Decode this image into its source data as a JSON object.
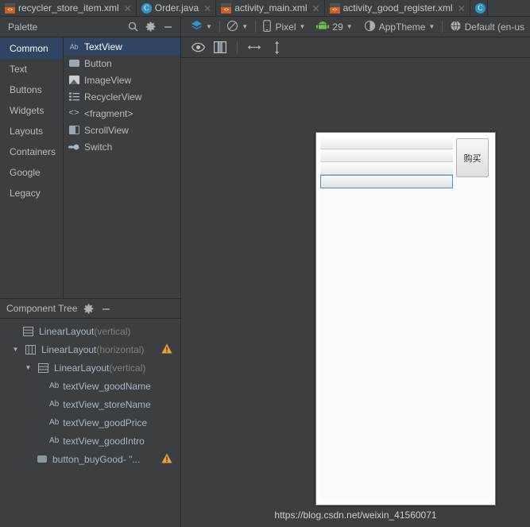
{
  "tabs": [
    {
      "label": "recycler_store_item.xml",
      "icon": "xml-file-icon",
      "active": true,
      "closeable": true
    },
    {
      "label": "Order.java",
      "icon": "java-class-icon",
      "active": false,
      "closeable": true
    },
    {
      "label": "activity_main.xml",
      "icon": "xml-file-icon",
      "active": false,
      "closeable": true
    },
    {
      "label": "activity_good_register.xml",
      "icon": "xml-file-icon",
      "active": false,
      "closeable": true
    },
    {
      "label": "",
      "icon": "java-class-icon",
      "active": false,
      "closeable": false
    }
  ],
  "palette": {
    "title": "Palette",
    "search_icon": "search-icon",
    "settings_icon": "gear-icon",
    "minimize_icon": "minimize-icon",
    "categories": [
      {
        "label": "Common",
        "selected": true
      },
      {
        "label": "Text",
        "selected": false
      },
      {
        "label": "Buttons",
        "selected": false
      },
      {
        "label": "Widgets",
        "selected": false
      },
      {
        "label": "Layouts",
        "selected": false
      },
      {
        "label": "Containers",
        "selected": false
      },
      {
        "label": "Google",
        "selected": false
      },
      {
        "label": "Legacy",
        "selected": false
      }
    ],
    "items": [
      {
        "label": "TextView",
        "icon": "textview-icon",
        "selected": true
      },
      {
        "label": "Button",
        "icon": "button-icon",
        "selected": false
      },
      {
        "label": "ImageView",
        "icon": "imageview-icon",
        "selected": false
      },
      {
        "label": "RecyclerView",
        "icon": "recyclerview-icon",
        "selected": false
      },
      {
        "label": "<fragment>",
        "icon": "fragment-icon",
        "selected": false
      },
      {
        "label": "ScrollView",
        "icon": "scrollview-icon",
        "selected": false
      },
      {
        "label": "Switch",
        "icon": "switch-icon",
        "selected": false
      }
    ]
  },
  "component_tree": {
    "title": "Component Tree",
    "settings_icon": "gear-icon",
    "minimize_icon": "minimize-icon",
    "rows": [
      {
        "name": "LinearLayout",
        "suffix": "(vertical)",
        "indent": 0,
        "twisty": "none",
        "icon": "linearlayout-vertical-icon",
        "warning": false
      },
      {
        "name": "LinearLayout",
        "suffix": "(horizontal)",
        "indent": 1,
        "twisty": "open",
        "icon": "linearlayout-horizontal-icon",
        "warning": true
      },
      {
        "name": "LinearLayout",
        "suffix": "(vertical)",
        "indent": 2,
        "twisty": "open",
        "icon": "linearlayout-vertical-icon",
        "warning": false
      },
      {
        "name": "textView_goodName",
        "suffix": "",
        "indent": 3,
        "twisty": "none",
        "icon": "textview-icon",
        "warning": false
      },
      {
        "name": "textView_storeName",
        "suffix": "",
        "indent": 3,
        "twisty": "none",
        "icon": "textview-icon",
        "warning": false
      },
      {
        "name": "textView_goodPrice",
        "suffix": "",
        "indent": 3,
        "twisty": "none",
        "icon": "textview-icon",
        "warning": false
      },
      {
        "name": "textView_goodIntro",
        "suffix": "",
        "indent": 3,
        "twisty": "none",
        "icon": "textview-icon",
        "warning": false
      },
      {
        "name": "button_buyGood- \"...",
        "suffix": "",
        "indent": 2,
        "twisty": "none",
        "icon": "button-icon",
        "warning": true
      }
    ]
  },
  "design_toolbar": {
    "items": [
      {
        "label": "",
        "icon": "design-surface-icon",
        "caret": true
      },
      {
        "label": "",
        "icon": "blueprint-icon",
        "caret": true
      },
      {
        "label": "Pixel",
        "icon": "device-icon",
        "caret": true
      },
      {
        "label": "29",
        "icon": "android-icon",
        "caret": true
      },
      {
        "label": "AppTheme",
        "icon": "theme-icon",
        "caret": true
      },
      {
        "label": "Default (en-us",
        "icon": "locale-globe-icon",
        "caret": false
      }
    ]
  },
  "view_toolbar": {
    "items": [
      {
        "icon": "eye-icon"
      },
      {
        "icon": "layout-columns-icon"
      },
      {
        "icon": "resize-horizontal-icon"
      },
      {
        "icon": "resize-vertical-icon"
      }
    ]
  },
  "preview": {
    "buy_button_label": "购买",
    "text_rows": 4,
    "selected_row_index": 3
  },
  "watermark": "https://blog.csdn.net/weixin_41560071",
  "colors": {
    "background": "#3c3f41",
    "selection": "#2f4563",
    "accent": "#3592c4",
    "warning": "#e8a33d",
    "error": "#cc3c3c",
    "xml_icon": "#cc5f20"
  }
}
